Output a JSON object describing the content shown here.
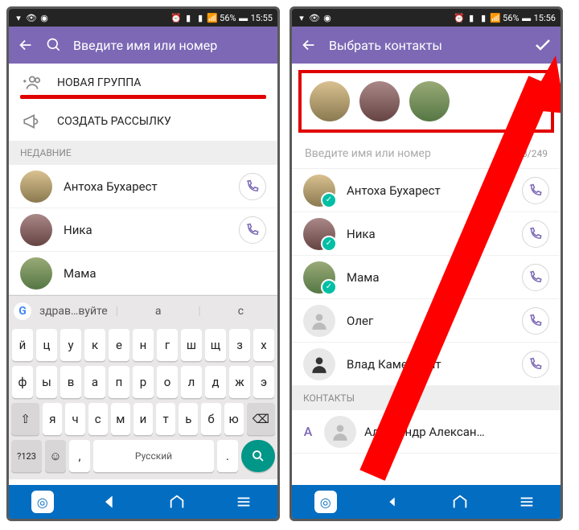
{
  "status": {
    "battery": "56%",
    "time1": "15:55",
    "time2": "15:56"
  },
  "screen1": {
    "search_placeholder": "Введите имя или номер",
    "new_group": "НОВАЯ ГРУППА",
    "create_broadcast": "СОЗДАТЬ РАССЫЛКУ",
    "recent": "НЕДАВНИЕ",
    "contacts": [
      {
        "name": "Антоха Бухарест"
      },
      {
        "name": "Ника"
      },
      {
        "name": "Мама"
      }
    ],
    "suggest1": "здрав…вуйте",
    "suggest2": "а",
    "suggest3": "с"
  },
  "screen2": {
    "title": "Выбрать контакты",
    "search_placeholder": "Введите имя или номер",
    "counter": "3/249",
    "section_contacts": "КОНТАКТЫ",
    "letter_a": "A",
    "contacts": [
      {
        "name": "Антоха Бухарест",
        "selected": true
      },
      {
        "name": "Ника",
        "selected": true
      },
      {
        "name": "Мама",
        "selected": true
      },
      {
        "name": "Олег",
        "placeholder": true
      },
      {
        "name": "Влад Камендант",
        "placeholder": true
      },
      {
        "name": "Александр Алексан…",
        "placeholder": true
      }
    ]
  },
  "keyboard": {
    "row1": [
      "й",
      "ц",
      "у",
      "к",
      "е",
      "н",
      "г",
      "ш",
      "щ",
      "з",
      "х"
    ],
    "row2": [
      "ф",
      "ы",
      "в",
      "а",
      "п",
      "р",
      "о",
      "л",
      "д",
      "ж",
      "э"
    ],
    "row3": [
      "я",
      "ч",
      "с",
      "м",
      "и",
      "т",
      "ь",
      "б",
      "ю"
    ],
    "shift": "⇧",
    "bksp": "⌫",
    "numkey": "?123",
    "emoji": "☺",
    "comma": ",",
    "space": "Русский",
    "dot": "."
  },
  "google_g": "G"
}
